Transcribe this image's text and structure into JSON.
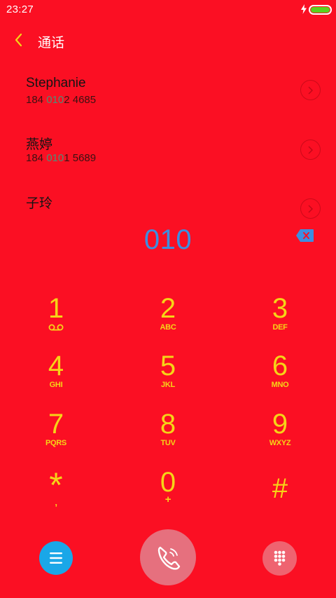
{
  "status_bar": {
    "time": "23:27"
  },
  "header": {
    "title": "通话"
  },
  "contacts": [
    {
      "name": "Stephanie",
      "number_prefix": "184 ",
      "number_match": "010",
      "number_suffix": "2 4685"
    },
    {
      "name": "燕婷",
      "number_prefix": "184 ",
      "number_match": "010",
      "number_suffix": "1 5689"
    },
    {
      "name": "子玲"
    }
  ],
  "dialer": {
    "entered_number": "010"
  },
  "keypad": {
    "keys": [
      {
        "digit": "1",
        "letters": "",
        "sub_icon": "voicemail-icon"
      },
      {
        "digit": "2",
        "letters": "ABC"
      },
      {
        "digit": "3",
        "letters": "DEF"
      },
      {
        "digit": "4",
        "letters": "GHI"
      },
      {
        "digit": "5",
        "letters": "JKL"
      },
      {
        "digit": "6",
        "letters": "MNO"
      },
      {
        "digit": "7",
        "letters": "PQRS"
      },
      {
        "digit": "8",
        "letters": "TUV"
      },
      {
        "digit": "9",
        "letters": "WXYZ"
      },
      {
        "digit": "*",
        "letters": ","
      },
      {
        "digit": "0",
        "letters": "+"
      },
      {
        "digit": "#",
        "letters": ""
      }
    ]
  },
  "bottom_bar": {
    "menu_icon": "menu-icon",
    "call_icon": "phone-icon",
    "dialpad_icon": "dialpad-icon"
  },
  "colors": {
    "background": "#fb0f23",
    "keypad_text": "#f6d417",
    "entered_number": "#3d8ee0",
    "menu_button": "#1aa7e8",
    "call_button": "#e6707e",
    "dialpad_toggle": "#ef6370",
    "number_match": "#4c8f78",
    "battery": "#5ad21e"
  }
}
